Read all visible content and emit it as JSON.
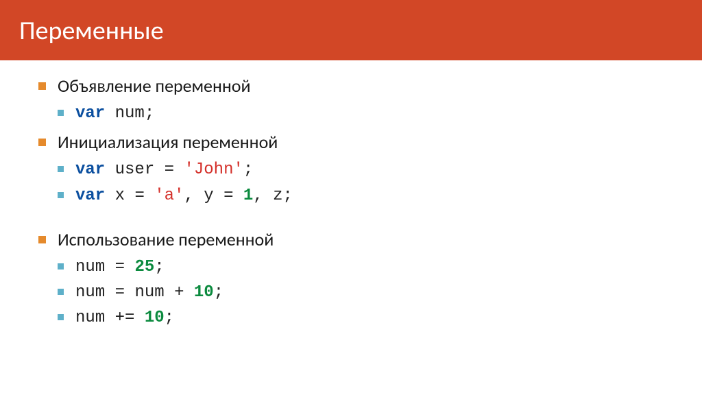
{
  "slide": {
    "title": "Переменные"
  },
  "sections": [
    {
      "heading": "Объявление переменной",
      "code": [
        {
          "tokens": [
            {
              "t": "var",
              "c": "c-keyword"
            },
            {
              "t": " ",
              "c": ""
            },
            {
              "t": "num",
              "c": "c-ident"
            },
            {
              "t": ";",
              "c": "c-punct"
            }
          ]
        }
      ]
    },
    {
      "heading": "Инициализация переменной",
      "code": [
        {
          "tokens": [
            {
              "t": "var",
              "c": "c-keyword"
            },
            {
              "t": " ",
              "c": ""
            },
            {
              "t": "user",
              "c": "c-ident"
            },
            {
              "t": " ",
              "c": ""
            },
            {
              "t": "=",
              "c": "c-op"
            },
            {
              "t": " ",
              "c": ""
            },
            {
              "t": "'John'",
              "c": "c-string"
            },
            {
              "t": ";",
              "c": "c-punct"
            }
          ]
        },
        {
          "tokens": [
            {
              "t": "var",
              "c": "c-keyword"
            },
            {
              "t": " ",
              "c": ""
            },
            {
              "t": "x",
              "c": "c-ident"
            },
            {
              "t": " ",
              "c": ""
            },
            {
              "t": "=",
              "c": "c-op"
            },
            {
              "t": " ",
              "c": ""
            },
            {
              "t": "'a'",
              "c": "c-string"
            },
            {
              "t": ",",
              "c": "c-punct"
            },
            {
              "t": " ",
              "c": ""
            },
            {
              "t": "y",
              "c": "c-ident"
            },
            {
              "t": " ",
              "c": ""
            },
            {
              "t": "=",
              "c": "c-op"
            },
            {
              "t": " ",
              "c": ""
            },
            {
              "t": "1",
              "c": "c-number"
            },
            {
              "t": ",",
              "c": "c-punct"
            },
            {
              "t": " ",
              "c": ""
            },
            {
              "t": "z",
              "c": "c-ident"
            },
            {
              "t": ";",
              "c": "c-punct"
            }
          ]
        }
      ]
    },
    {
      "heading": "Использование переменной",
      "code": [
        {
          "tokens": [
            {
              "t": "num",
              "c": "c-ident"
            },
            {
              "t": " ",
              "c": ""
            },
            {
              "t": "=",
              "c": "c-op"
            },
            {
              "t": " ",
              "c": ""
            },
            {
              "t": "25",
              "c": "c-number"
            },
            {
              "t": ";",
              "c": "c-punct"
            }
          ]
        },
        {
          "tokens": [
            {
              "t": "num",
              "c": "c-ident"
            },
            {
              "t": " ",
              "c": ""
            },
            {
              "t": "=",
              "c": "c-op"
            },
            {
              "t": " ",
              "c": ""
            },
            {
              "t": "num",
              "c": "c-ident"
            },
            {
              "t": " ",
              "c": ""
            },
            {
              "t": "+",
              "c": "c-op"
            },
            {
              "t": " ",
              "c": ""
            },
            {
              "t": "10",
              "c": "c-number"
            },
            {
              "t": ";",
              "c": "c-punct"
            }
          ]
        },
        {
          "tokens": [
            {
              "t": "num",
              "c": "c-ident"
            },
            {
              "t": " ",
              "c": ""
            },
            {
              "t": "+=",
              "c": "c-op"
            },
            {
              "t": " ",
              "c": ""
            },
            {
              "t": "10",
              "c": "c-number"
            },
            {
              "t": ";",
              "c": "c-punct"
            }
          ]
        }
      ]
    }
  ]
}
